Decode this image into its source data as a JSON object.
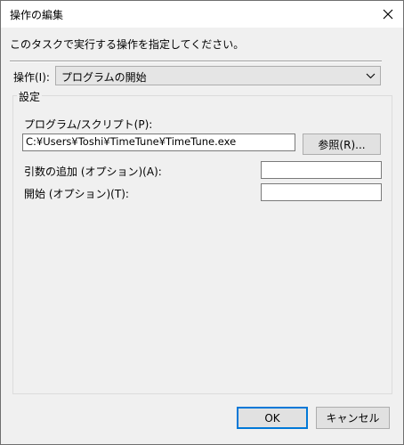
{
  "window": {
    "title": "操作の編集"
  },
  "instruction": "このタスクで実行する操作を指定してください。",
  "action": {
    "label": "操作(I):",
    "selected": "プログラムの開始"
  },
  "settings": {
    "group_label": "設定",
    "program_label": "プログラム/スクリプト(P):",
    "program_value": "C:¥Users¥Toshi¥TimeTune¥TimeTune.exe",
    "browse_label": "参照(R)...",
    "args_label": "引数の追加 (オプション)(A):",
    "args_value": "",
    "start_label": "開始 (オプション)(T):",
    "start_value": ""
  },
  "buttons": {
    "ok": "OK",
    "cancel": "キャンセル"
  },
  "colors": {
    "accent": "#0078d7",
    "dialog_bg": "#f0f0f0"
  }
}
